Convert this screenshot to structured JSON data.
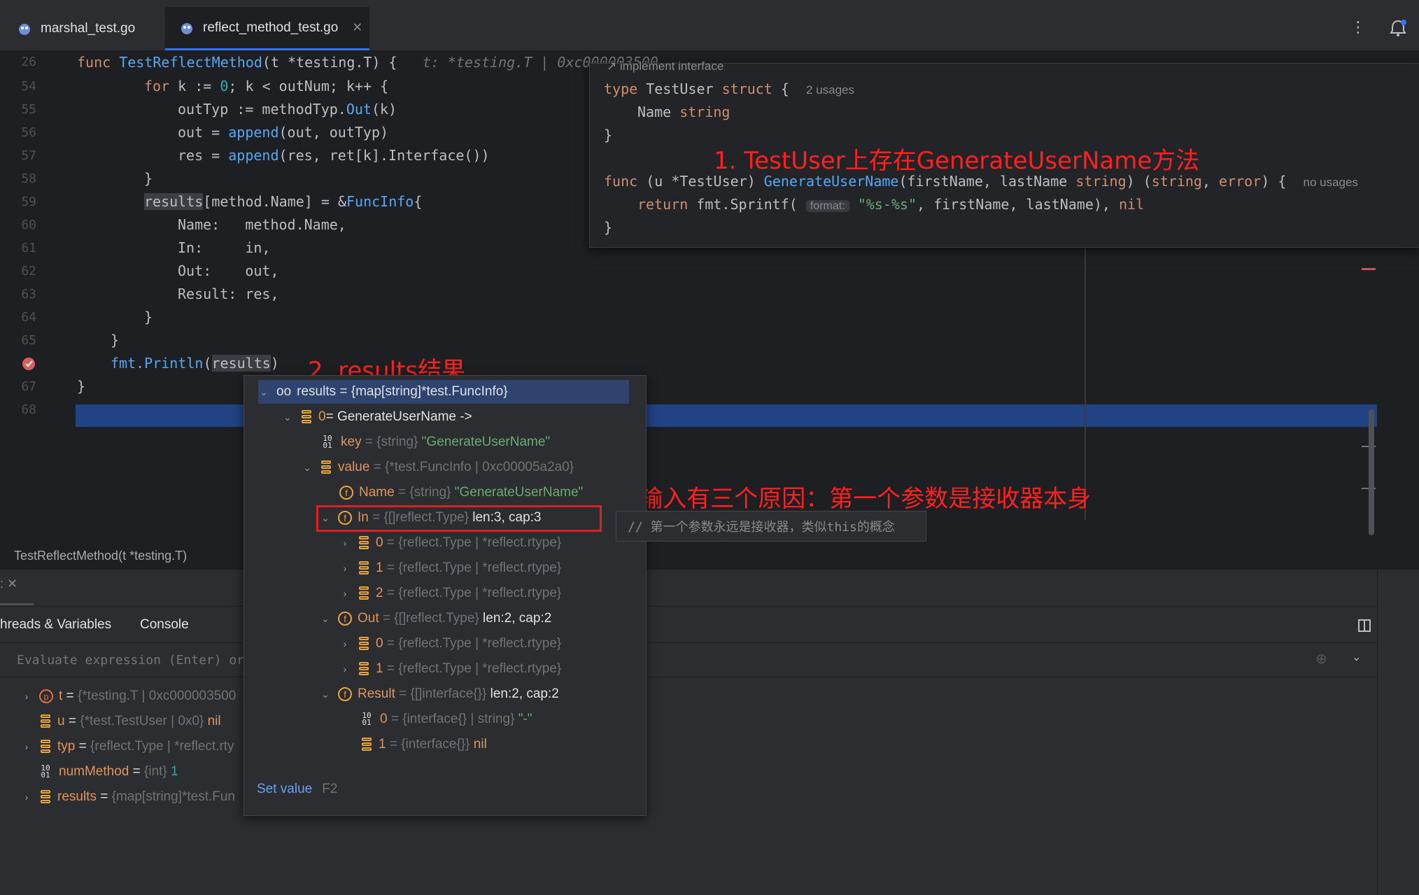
{
  "tabs": [
    {
      "label": "marshal_test.go",
      "active": false
    },
    {
      "label": "reflect_method_test.go",
      "active": true
    }
  ],
  "editor": {
    "lines": [
      {
        "num": "26",
        "html_key": "l26"
      },
      {
        "num": "54"
      },
      {
        "num": "55"
      },
      {
        "num": "56"
      },
      {
        "num": "57"
      },
      {
        "num": "58"
      },
      {
        "num": "59"
      },
      {
        "num": "60"
      },
      {
        "num": "61"
      },
      {
        "num": "62"
      },
      {
        "num": "63"
      },
      {
        "num": "64"
      },
      {
        "num": "65"
      },
      {
        "num": ""
      },
      {
        "num": "67"
      },
      {
        "num": "68"
      }
    ],
    "breadcrumb": "TestReflectMethod(t *testing.T)"
  },
  "popup": {
    "header": "implement interface",
    "usages_2": "2 usages",
    "no_usages": "no usages",
    "format_hint": "format:"
  },
  "annotations": {
    "a1": "1.  TestUser上存在GenerateUserName方法",
    "a2": "2. results结果",
    "a3": "3. 输入有三个原因：第一个参数是接收器本身"
  },
  "debug": {
    "tab_threads": "hreads & Variables",
    "tab_console": "Console",
    "eval_placeholder": "Evaluate expression (Enter) or",
    "vars": [
      {
        "name": "t",
        "type": "{*testing.T | 0xc000003500",
        "value": ""
      },
      {
        "name": "u",
        "type": "{*test.TestUser | 0x0}",
        "value": "nil"
      },
      {
        "name": "typ",
        "type": "{reflect.Type | *reflect.rty",
        "value": ""
      },
      {
        "name": "numMethod",
        "type": "{int}",
        "value": "1"
      },
      {
        "name": "results",
        "type": "{map[string]*test.Fun",
        "value": ""
      }
    ]
  },
  "tree": {
    "root": "results = {map[string]*test.FuncInfo}",
    "rows": [
      {
        "key": "0",
        "rest": " = GenerateUserName ->"
      },
      {
        "key": "key",
        "type": " = {string} ",
        "value": "\"GenerateUserName\""
      },
      {
        "key": "value",
        "type": " = {*test.FuncInfo | 0xc00005a2a0}"
      },
      {
        "key": "Name",
        "type": " = {string} ",
        "value": "\"GenerateUserName\""
      },
      {
        "key": "In",
        "type": " = {[]reflect.Type} ",
        "value": "len:3, cap:3"
      },
      {
        "key": "0",
        "type": " = {reflect.Type | *reflect.rtype}"
      },
      {
        "key": "1",
        "type": " = {reflect.Type | *reflect.rtype}"
      },
      {
        "key": "2",
        "type": " = {reflect.Type | *reflect.rtype}"
      },
      {
        "key": "Out",
        "type": " = {[]reflect.Type} ",
        "value": "len:2, cap:2"
      },
      {
        "key": "0",
        "type": " = {reflect.Type | *reflect.rtype}"
      },
      {
        "key": "1",
        "type": " = {reflect.Type | *reflect.rtype}"
      },
      {
        "key": "Result",
        "type": " = {[]interface{}} ",
        "value": "len:2, cap:2"
      },
      {
        "key": "0",
        "type": " = {interface{} | string} ",
        "value": "\"-\""
      },
      {
        "key": "1",
        "type": " = {interface{}} ",
        "value": "nil"
      }
    ],
    "set_value": "Set value",
    "set_value_key": "F2",
    "comment_hint": "// 第一个参数永远是接收器，类似this的概念"
  },
  "colors": {
    "accent": "#3574f0",
    "highlight": "#214283",
    "annotation": "#ff2020"
  }
}
